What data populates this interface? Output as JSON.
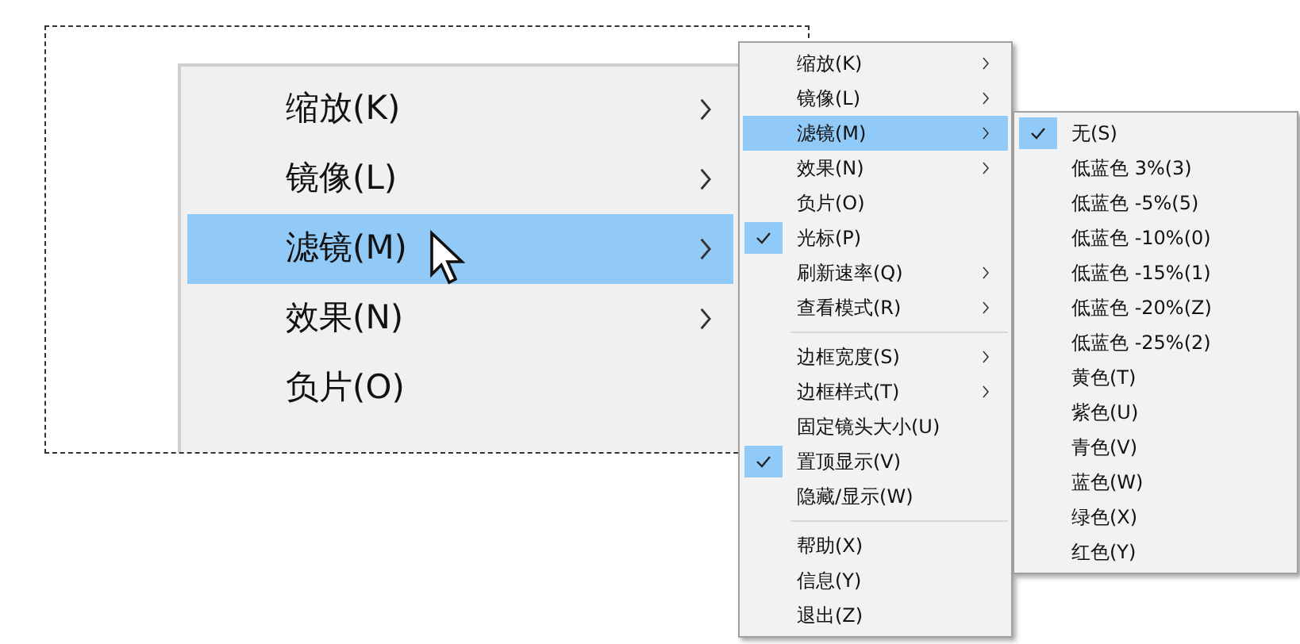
{
  "magnifier": {
    "items": [
      {
        "label": "缩放(K)",
        "has_submenu": true,
        "selected": false
      },
      {
        "label": "镜像(L)",
        "has_submenu": true,
        "selected": false
      },
      {
        "label": "滤镜(M)",
        "has_submenu": true,
        "selected": true
      },
      {
        "label": "效果(N)",
        "has_submenu": true,
        "selected": false
      },
      {
        "label": "负片(O)",
        "has_submenu": false,
        "selected": false
      }
    ]
  },
  "menu": {
    "groups": [
      [
        {
          "label": "缩放(K)",
          "has_submenu": true,
          "checked": false,
          "selected": false
        },
        {
          "label": "镜像(L)",
          "has_submenu": true,
          "checked": false,
          "selected": false
        },
        {
          "label": "滤镜(M)",
          "has_submenu": true,
          "checked": false,
          "selected": true
        },
        {
          "label": "效果(N)",
          "has_submenu": true,
          "checked": false,
          "selected": false
        },
        {
          "label": "负片(O)",
          "has_submenu": false,
          "checked": false,
          "selected": false
        },
        {
          "label": "光标(P)",
          "has_submenu": false,
          "checked": true,
          "selected": false
        },
        {
          "label": "刷新速率(Q)",
          "has_submenu": true,
          "checked": false,
          "selected": false
        },
        {
          "label": "查看模式(R)",
          "has_submenu": true,
          "checked": false,
          "selected": false
        }
      ],
      [
        {
          "label": "边框宽度(S)",
          "has_submenu": true,
          "checked": false,
          "selected": false
        },
        {
          "label": "边框样式(T)",
          "has_submenu": true,
          "checked": false,
          "selected": false
        },
        {
          "label": "固定镜头大小(U)",
          "has_submenu": false,
          "checked": false,
          "selected": false
        },
        {
          "label": "置顶显示(V)",
          "has_submenu": false,
          "checked": true,
          "selected": false
        },
        {
          "label": "隐藏/显示(W)",
          "has_submenu": false,
          "checked": false,
          "selected": false
        }
      ],
      [
        {
          "label": "帮助(X)",
          "has_submenu": false,
          "checked": false,
          "selected": false
        },
        {
          "label": "信息(Y)",
          "has_submenu": false,
          "checked": false,
          "selected": false
        },
        {
          "label": "退出(Z)",
          "has_submenu": false,
          "checked": false,
          "selected": false
        }
      ]
    ]
  },
  "submenu": {
    "items": [
      {
        "label": "无(S)",
        "checked": true
      },
      {
        "label": "低蓝色 3%(3)",
        "checked": false
      },
      {
        "label": "低蓝色 -5%(5)",
        "checked": false
      },
      {
        "label": "低蓝色 -10%(0)",
        "checked": false
      },
      {
        "label": "低蓝色 -15%(1)",
        "checked": false
      },
      {
        "label": "低蓝色 -20%(Z)",
        "checked": false
      },
      {
        "label": "低蓝色 -25%(2)",
        "checked": false
      },
      {
        "label": "黄色(T)",
        "checked": false
      },
      {
        "label": "紫色(U)",
        "checked": false
      },
      {
        "label": "青色(V)",
        "checked": false
      },
      {
        "label": "蓝色(W)",
        "checked": false
      },
      {
        "label": "绿色(X)",
        "checked": false
      },
      {
        "label": "红色(Y)",
        "checked": false
      }
    ]
  }
}
